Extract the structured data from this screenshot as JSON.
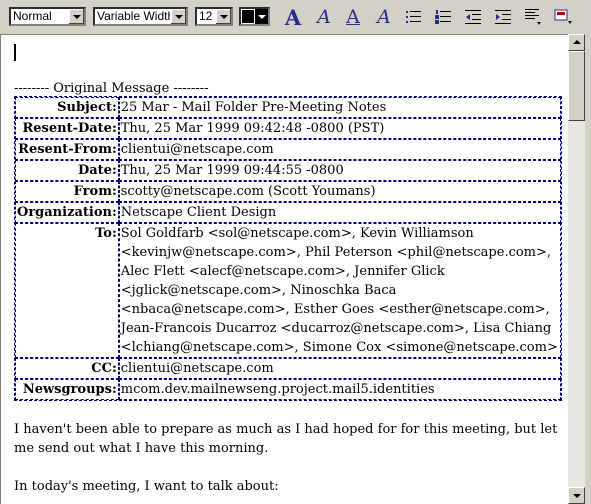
{
  "toolbar": {
    "paragraph_style": "Normal",
    "font_face": "Variable Width",
    "font_size": "12",
    "text_color": "#000000",
    "buttons": [
      {
        "name": "increase-font-size-icon",
        "glyph": "A"
      },
      {
        "name": "italic-style-icon",
        "glyph": "A"
      },
      {
        "name": "underline-style-icon",
        "glyph": "A"
      },
      {
        "name": "remove-styles-icon",
        "glyph": "A"
      },
      {
        "name": "bullet-list-icon"
      },
      {
        "name": "numbered-list-icon"
      },
      {
        "name": "decrease-indent-icon"
      },
      {
        "name": "increase-indent-icon"
      },
      {
        "name": "alignment-icon"
      },
      {
        "name": "insert-object-icon"
      }
    ]
  },
  "message": {
    "separator": "-------- Original Message --------",
    "headers": [
      {
        "key": "Subject:",
        "value": "25 Mar - Mail Folder Pre-Meeting Notes"
      },
      {
        "key": "Resent-Date:",
        "value": "Thu, 25 Mar 1999 09:42:48 -0800 (PST)"
      },
      {
        "key": "Resent-From:",
        "value": "clientui@netscape.com"
      },
      {
        "key": "Date:",
        "value": "Thu, 25 Mar 1999 09:44:55 -0800"
      },
      {
        "key": "From:",
        "value": "scotty@netscape.com (Scott Youmans)"
      },
      {
        "key": "Organization:",
        "value": "Netscape Client Design"
      },
      {
        "key": "To:",
        "value": "Sol Goldfarb <sol@netscape.com>, Kevin Williamson <kevinjw@netscape.com>, Phil Peterson <phil@netscape.com>, Alec Flett <alecf@netscape.com>, Jennifer Glick <jglick@netscape.com>, Ninoschka Baca <nbaca@netscape.com>, Esther Goes <esther@netscape.com>, Jean-Francois Ducarroz <ducarroz@netscape.com>, Lisa Chiang <lchiang@netscape.com>, Simone Cox <simone@netscape.com>"
      },
      {
        "key": "CC:",
        "value": "clientui@netscape.com"
      },
      {
        "key": "Newsgroups:",
        "value": "mcom.dev.mailnewseng.project.mail5.identities"
      }
    ],
    "body": [
      "I haven't been able to prepare as much as I had hoped for for this meeting, but let me send out what I have this morning.",
      "In today's meeting, I want to talk about:"
    ]
  },
  "colors": {
    "chrome": "#d4d0c8",
    "table_border": "#000080",
    "icon_blue": "#1f2f8a"
  }
}
